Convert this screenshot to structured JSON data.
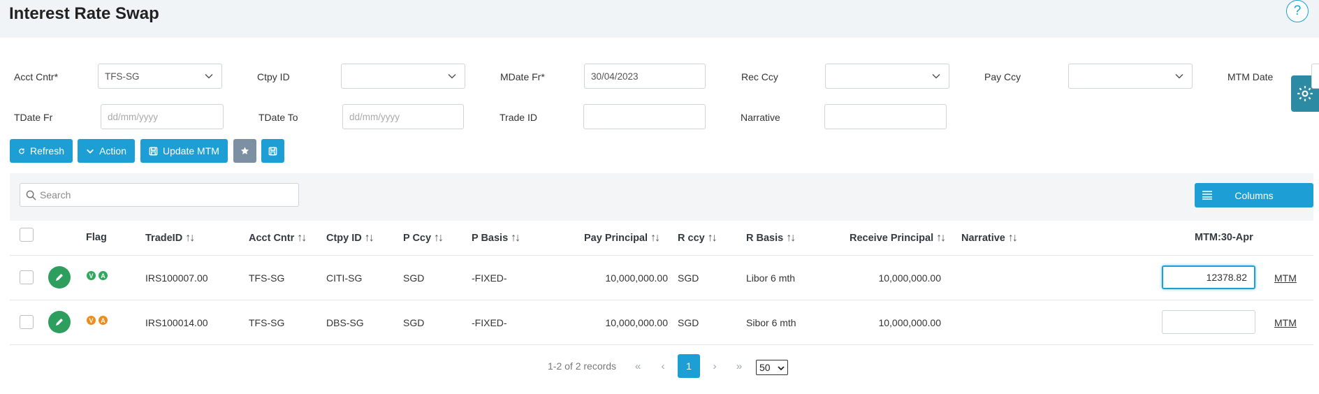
{
  "header": {
    "title": "Interest Rate Swap",
    "help_glyph": "?"
  },
  "filters": {
    "acct_cntr": {
      "label": "Acct Cntr*",
      "value": "TFS-SG"
    },
    "ctpy_id": {
      "label": "Ctpy ID",
      "value": ""
    },
    "mdate_fr": {
      "label": "MDate Fr*",
      "value": "30/04/2023"
    },
    "rec_ccy": {
      "label": "Rec Ccy",
      "value": ""
    },
    "pay_ccy": {
      "label": "Pay Ccy",
      "value": ""
    },
    "mtm_date": {
      "label": "MTM Date"
    },
    "tdate_fr": {
      "label": "TDate Fr",
      "placeholder": "dd/mm/yyyy"
    },
    "tdate_to": {
      "label": "TDate To",
      "placeholder": "dd/mm/yyyy"
    },
    "trade_id": {
      "label": "Trade ID",
      "value": ""
    },
    "narrative": {
      "label": "Narrative",
      "value": ""
    }
  },
  "toolbar": {
    "refresh": "Refresh",
    "action": "Action",
    "update_mtm": "Update MTM"
  },
  "grid": {
    "search_placeholder": "Search",
    "columns_label": "Columns",
    "headers": {
      "flag": "Flag",
      "trade_id": "TradeID",
      "acct_cntr": "Acct Cntr",
      "ctpy_id": "Ctpy ID",
      "p_ccy": "P Ccy",
      "p_basis": "P Basis",
      "pay_principal": "Pay Principal",
      "r_ccy": "R ccy",
      "r_basis": "R Basis",
      "receive_principal": "Receive Principal",
      "narrative": "Narrative",
      "mtm": "MTM:30-Apr"
    },
    "sort_glyph": "↑↓",
    "rows": [
      {
        "flags": [
          "V",
          "A"
        ],
        "flag_color": "#2eaa5c",
        "trade_id": "IRS100007.00",
        "acct_cntr": "TFS-SG",
        "ctpy_id": "CITI-SG",
        "p_ccy": "SGD",
        "p_basis": "-FIXED-",
        "pay_principal": "10,000,000.00",
        "r_ccy": "SGD",
        "r_basis": "Libor 6 mth",
        "receive_principal": "10,000,000.00",
        "narrative": "",
        "mtm_value": "12378.82",
        "mtm_link": "MTM"
      },
      {
        "flags": [
          "V",
          "A"
        ],
        "flag_color": "#f08c1e",
        "trade_id": "IRS100014.00",
        "acct_cntr": "TFS-SG",
        "ctpy_id": "DBS-SG",
        "p_ccy": "SGD",
        "p_basis": "-FIXED-",
        "pay_principal": "10,000,000.00",
        "r_ccy": "SGD",
        "r_basis": "Sibor 6 mth",
        "receive_principal": "10,000,000.00",
        "narrative": "",
        "mtm_value": "",
        "mtm_link": "MTM"
      }
    ]
  },
  "pager": {
    "summary": "1-2 of 2 records",
    "first": "«",
    "prev": "‹",
    "current": "1",
    "next": "›",
    "last": "»",
    "page_size": "50"
  },
  "colors": {
    "accent": "#1d9fd6",
    "edit_green": "#2e9e5e",
    "gear_tab": "#2c8ba3"
  }
}
